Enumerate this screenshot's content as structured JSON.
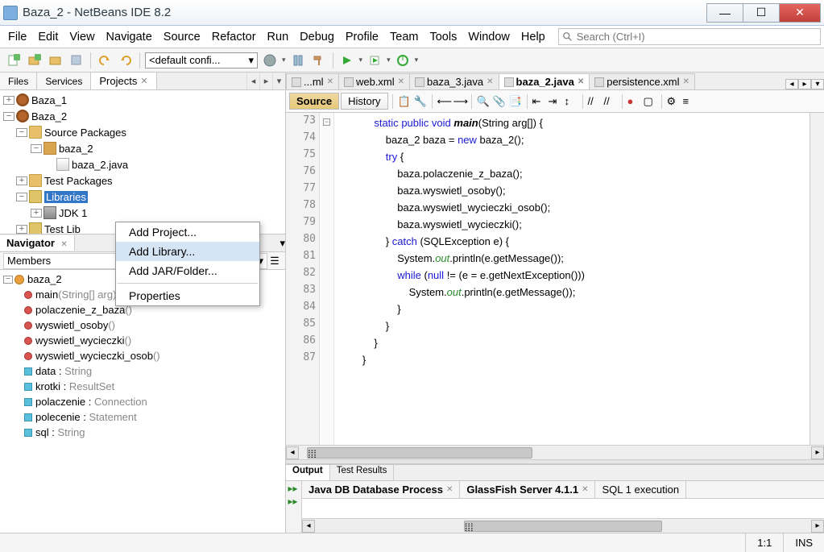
{
  "window": {
    "title": "Baza_2 - NetBeans IDE 8.2"
  },
  "menu": [
    "File",
    "Edit",
    "View",
    "Navigate",
    "Source",
    "Refactor",
    "Run",
    "Debug",
    "Profile",
    "Team",
    "Tools",
    "Window",
    "Help"
  ],
  "search": {
    "placeholder": "Search (Ctrl+I)"
  },
  "toolbar": {
    "config": "<default confi..."
  },
  "left_tabs": {
    "files": "Files",
    "services": "Services",
    "projects": "Projects"
  },
  "tree": {
    "baza1": "Baza_1",
    "baza2": "Baza_2",
    "src_packages": "Source Packages",
    "pkg": "baza_2",
    "file": "baza_2.java",
    "test_packages": "Test Packages",
    "libraries": "Libraries",
    "jdk": "JDK 1",
    "test_lib": "Test Lib"
  },
  "context_menu": {
    "add_project": "Add Project...",
    "add_library": "Add Library...",
    "add_jar": "Add JAR/Folder...",
    "properties": "Properties"
  },
  "navigator": {
    "title": "Navigator",
    "members": "Members",
    "class": "baza_2",
    "methods": [
      {
        "name": "main",
        "args": "(String[] arg)",
        "kind": "static"
      },
      {
        "name": "polaczenie_z_baza",
        "args": "()",
        "kind": "method"
      },
      {
        "name": "wyswietl_osoby",
        "args": "()",
        "kind": "method"
      },
      {
        "name": "wyswietl_wycieczki",
        "args": "()",
        "kind": "method"
      },
      {
        "name": "wyswietl_wycieczki_osob",
        "args": "()",
        "kind": "method"
      }
    ],
    "fields": [
      {
        "name": "data",
        "type": "String"
      },
      {
        "name": "krotki",
        "type": "ResultSet"
      },
      {
        "name": "polaczenie",
        "type": "Connection"
      },
      {
        "name": "polecenie",
        "type": "Statement"
      },
      {
        "name": "sql",
        "type": "String"
      }
    ]
  },
  "editor": {
    "tabs": [
      "...ml",
      "web.xml",
      "baza_3.java",
      "baza_2.java",
      "persistence.xml"
    ],
    "active_tab": 3,
    "source_btn": "Source",
    "history_btn": "History",
    "lines": [
      73,
      74,
      75,
      76,
      77,
      78,
      79,
      80,
      81,
      82,
      83,
      84,
      85,
      86,
      87
    ],
    "code_lines": [
      {
        "indent": 3,
        "tokens": [
          {
            "t": "static",
            "c": "kw"
          },
          {
            "t": " "
          },
          {
            "t": "public",
            "c": "kw"
          },
          {
            "t": " "
          },
          {
            "t": "void",
            "c": "kw"
          },
          {
            "t": " "
          },
          {
            "t": "main",
            "c": "fn"
          },
          {
            "t": "(String arg[]) {"
          }
        ]
      },
      {
        "indent": 4,
        "tokens": [
          {
            "t": "baza_2 baza = "
          },
          {
            "t": "new",
            "c": "kw"
          },
          {
            "t": " baza_2();"
          }
        ]
      },
      {
        "indent": 4,
        "tokens": [
          {
            "t": "try",
            "c": "kw"
          },
          {
            "t": " {"
          }
        ]
      },
      {
        "indent": 5,
        "tokens": [
          {
            "t": "baza.polaczenie_z_baza();"
          }
        ]
      },
      {
        "indent": 5,
        "tokens": [
          {
            "t": "baza.wyswietl_osoby();"
          }
        ]
      },
      {
        "indent": 5,
        "tokens": [
          {
            "t": "baza.wyswietl_wycieczki_osob();"
          }
        ]
      },
      {
        "indent": 5,
        "tokens": [
          {
            "t": "baza.wyswietl_wycieczki();"
          }
        ]
      },
      {
        "indent": 4,
        "tokens": [
          {
            "t": "} "
          },
          {
            "t": "catch",
            "c": "kw"
          },
          {
            "t": " (SQLException e) {"
          }
        ]
      },
      {
        "indent": 5,
        "tokens": [
          {
            "t": "System."
          },
          {
            "t": "out",
            "c": "field"
          },
          {
            "t": ".println(e.getMessage());"
          }
        ]
      },
      {
        "indent": 5,
        "tokens": [
          {
            "t": "while",
            "c": "kw"
          },
          {
            "t": " ("
          },
          {
            "t": "null",
            "c": "kw"
          },
          {
            "t": " != (e = e.getNextException()))"
          }
        ]
      },
      {
        "indent": 6,
        "tokens": [
          {
            "t": "System."
          },
          {
            "t": "out",
            "c": "field"
          },
          {
            "t": ".println(e.getMessage());"
          }
        ]
      },
      {
        "indent": 5,
        "tokens": [
          {
            "t": "}"
          }
        ]
      },
      {
        "indent": 4,
        "tokens": [
          {
            "t": "}"
          }
        ]
      },
      {
        "indent": 3,
        "tokens": [
          {
            "t": "}"
          }
        ]
      },
      {
        "indent": 2,
        "tokens": [
          {
            "t": "}"
          }
        ]
      }
    ]
  },
  "output": {
    "tab1": "Output",
    "tab2": "Test Results",
    "sub1": "Java DB Database Process",
    "sub2": "GlassFish Server 4.1.1",
    "sub3": "SQL 1 execution"
  },
  "status": {
    "pos": "1:1",
    "mode": "INS"
  }
}
